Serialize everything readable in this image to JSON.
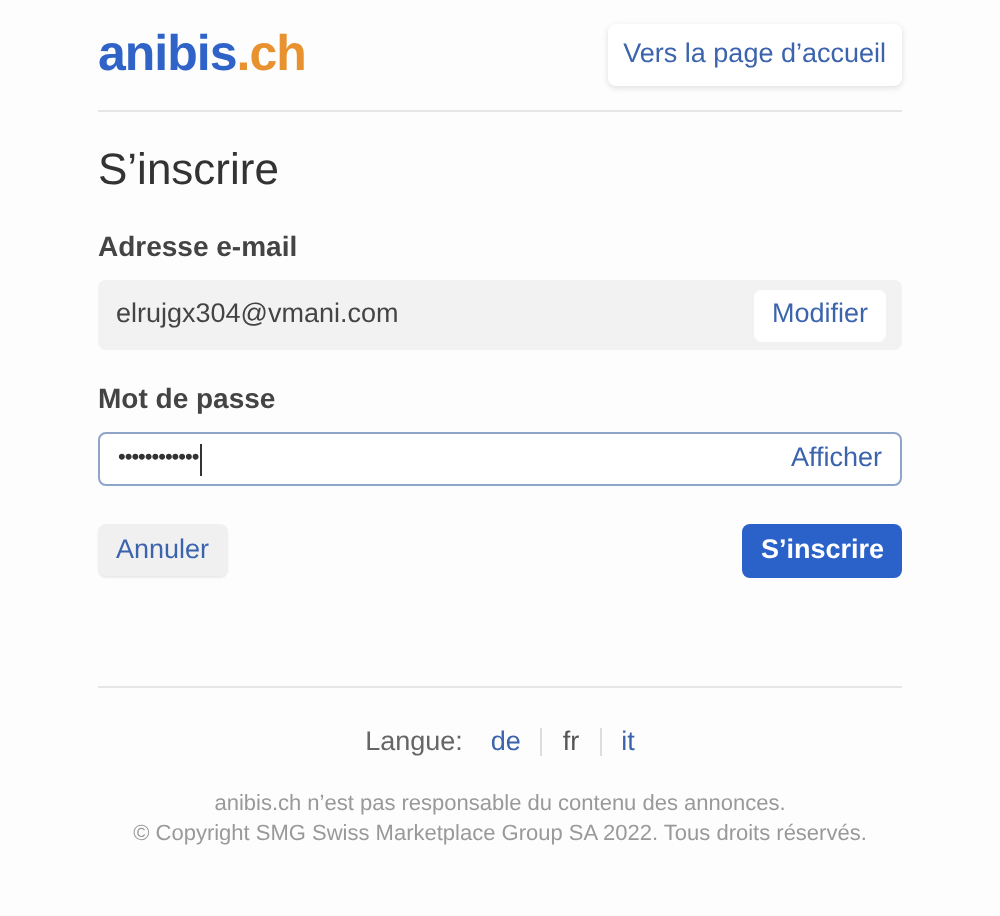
{
  "header": {
    "logo": {
      "name": "anibis",
      "suffix": ".ch"
    },
    "home_link": "Vers la page d’accueil"
  },
  "title": "S’inscrire",
  "email": {
    "label": "Adresse e-mail",
    "value": "elrujgx304@vmani.com",
    "action": "Modifier"
  },
  "password": {
    "label": "Mot de passe",
    "value": "••••••••••••",
    "action": "Afficher",
    "focused": true
  },
  "buttons": {
    "cancel": "Annuler",
    "submit": "S’inscrire"
  },
  "footer": {
    "language_label": "Langue:",
    "languages": [
      {
        "label": "de",
        "selected": false
      },
      {
        "label": "fr",
        "selected": true
      },
      {
        "label": "it",
        "selected": false
      }
    ],
    "disclaimer": "anibis.ch n’est pas responsable du contenu des annonces.",
    "copyright": "© Copyright SMG Swiss Marketplace Group SA 2022. Tous droits réservés."
  }
}
